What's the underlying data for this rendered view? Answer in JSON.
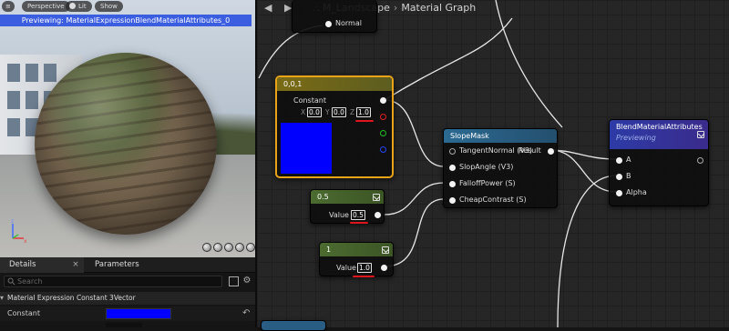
{
  "viewport": {
    "menu_icon": "≡",
    "perspective_label": "Perspective",
    "lit_label": "Lit",
    "show_label": "Show",
    "preview_banner": "Previewing: MaterialExpressionBlendMaterialAttributes_0"
  },
  "tabs": {
    "details_label": "Details",
    "parameters_label": "Parameters"
  },
  "details": {
    "search_placeholder": "Search",
    "section_title": "Material Expression Constant 3Vector",
    "constant_label": "Constant",
    "constant_color": "#0000ff"
  },
  "graph": {
    "breadcrumb": {
      "root": "M_Landscape",
      "page": "Material Graph"
    },
    "normal_label": "Normal",
    "constant3_node": {
      "title": "0,0,1",
      "label": "Constant",
      "x_label": "X",
      "x_value": "0.0",
      "y_label": "Y",
      "y_value": "0.0",
      "z_label": "Z",
      "z_value": "1.0",
      "preview_color": "#0000ff",
      "header_color": "#6b6a1e",
      "highlight_color": "#e8a318"
    },
    "const_half_node": {
      "title": "0.5",
      "label": "Value",
      "value": "0.5",
      "header_color": "#4e6b32"
    },
    "const_one_node": {
      "title": "1",
      "label": "Value",
      "value": "1.0",
      "header_color": "#4e6b32"
    },
    "slopemask_node": {
      "title": "SlopeMask",
      "header_color": "#2a5d84",
      "inputs": [
        "TangentNormal (V3)",
        "SlopAngle (V3)",
        "FalloffPower (S)",
        "CheapContrast (S)"
      ],
      "output": "Result"
    },
    "blend_node": {
      "title": "BlendMaterialAttributes",
      "subtitle": "Previewing",
      "header_color": "#2f3fb0",
      "inputs": [
        "A",
        "B",
        "Alpha"
      ]
    }
  }
}
